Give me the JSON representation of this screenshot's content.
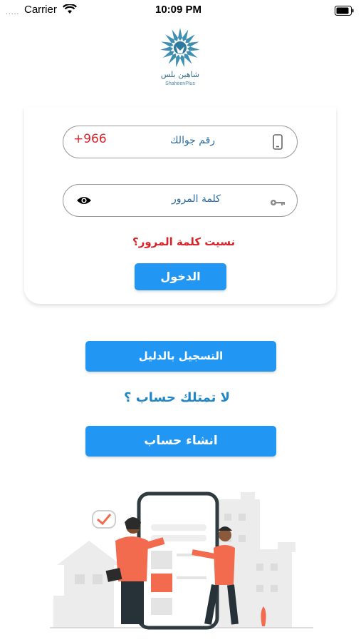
{
  "status_bar": {
    "dots": ".....",
    "carrier": "Carrier",
    "time": "10:09 PM"
  },
  "logo": {
    "name": "شاهين بلس",
    "sub": "ShaheenPlus"
  },
  "phone_field": {
    "prefix": "+966",
    "label": "رقم جوالك"
  },
  "password_field": {
    "label": "كلمة المرور"
  },
  "forgot_password": "نسيت كلمة المرور؟",
  "login_button": "الدخول",
  "guide_button": "التسجيل بالدليل",
  "no_account": "لا تمتلك حساب ؟",
  "create_account_button": "انشاء حساب",
  "colors": {
    "primary": "#2196f3",
    "accent_red": "#d8232a",
    "label_blue": "#2a6aa0",
    "illustration_orange": "#f26b4f"
  },
  "icons": [
    "wifi-icon",
    "battery-icon",
    "phone-icon",
    "eye-icon",
    "key-icon",
    "logo-emblem-icon"
  ]
}
